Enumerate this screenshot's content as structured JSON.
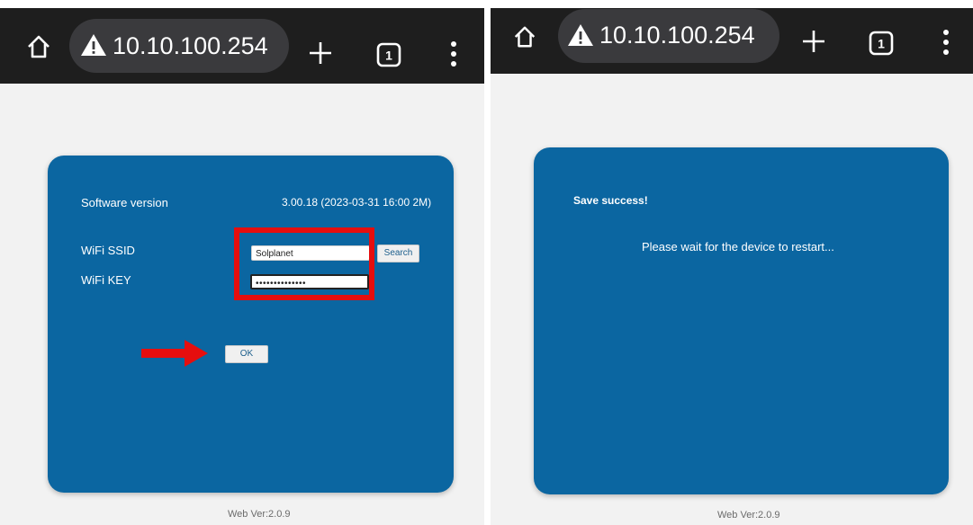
{
  "left": {
    "browser": {
      "url": "10.10.100.254",
      "tab_count": "1"
    },
    "config": {
      "software_version_label": "Software version",
      "software_version_value": "3.00.18 (2023-03-31 16:00 2M)",
      "ssid_label": "WiFi SSID",
      "ssid_value": "Solplanet",
      "search_label": "Search",
      "key_label": "WiFi KEY",
      "key_value": "••••••••••••••",
      "ok_label": "OK"
    },
    "footer": "Web Ver:2.0.9",
    "annotation_color": "#e60e0e"
  },
  "right": {
    "browser": {
      "url": "10.10.100.254",
      "tab_count": "1"
    },
    "message": {
      "title": "Save success!",
      "body": "Please wait for the device to restart..."
    },
    "footer": "Web Ver:2.0.9"
  },
  "colors": {
    "panel": "#0b66a1",
    "toolbar": "#1e1e1e",
    "url_pill": "#3a3a3d",
    "page_background": "#f2f2f2"
  },
  "icons": [
    "home-icon",
    "warning-icon",
    "plus-icon",
    "tabs-icon",
    "menu-icon",
    "red-arrow-icon"
  ]
}
